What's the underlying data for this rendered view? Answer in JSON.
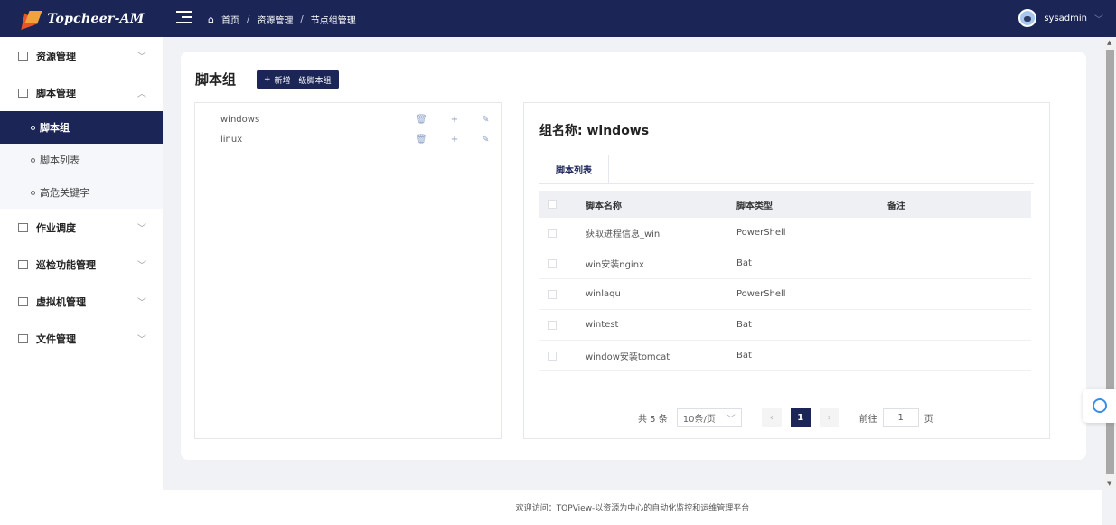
{
  "brand": {
    "logo_text": "Topcheer-AM"
  },
  "breadcrumb": {
    "home": "首页",
    "items": [
      "资源管理",
      "节点组管理"
    ],
    "separator": "/"
  },
  "user": {
    "name": "sysadmin"
  },
  "sidebar": {
    "items": [
      {
        "label": "资源管理",
        "arrow": "﹀"
      },
      {
        "label": "脚本管理",
        "arrow": "︿"
      },
      {
        "label": "作业调度",
        "arrow": "﹀"
      },
      {
        "label": "巡检功能管理",
        "arrow": "﹀"
      },
      {
        "label": "虚拟机管理",
        "arrow": "﹀"
      },
      {
        "label": "文件管理",
        "arrow": "﹀"
      }
    ],
    "sub_items": [
      {
        "label": "脚本组",
        "active": true
      },
      {
        "label": "脚本列表",
        "active": false
      },
      {
        "label": "高危关键字",
        "active": false
      }
    ]
  },
  "main": {
    "title": "脚本组",
    "add_button": "新增一级脚本组",
    "tree": [
      {
        "label": "windows"
      },
      {
        "label": "linux"
      }
    ],
    "detail": {
      "group_label": "组名称: windows",
      "tab": "脚本列表",
      "columns": [
        "脚本名称",
        "脚本类型",
        "备注"
      ],
      "rows": [
        {
          "name": "获取进程信息_win",
          "type": "PowerShell",
          "note": ""
        },
        {
          "name": "win安装nginx",
          "type": "Bat",
          "note": ""
        },
        {
          "name": "winlaqu",
          "type": "PowerShell",
          "note": ""
        },
        {
          "name": "wintest",
          "type": "Bat",
          "note": ""
        },
        {
          "name": "window安装tomcat",
          "type": "Bat",
          "note": ""
        }
      ],
      "pagination": {
        "total": "共 5 条",
        "page_size": "10条/页",
        "current": "1",
        "goto_label": "前往",
        "goto_value": "1",
        "page_unit": "页"
      }
    }
  },
  "footer": "欢迎访问：TOPView-以资源为中心的自动化监控和运维管理平台",
  "colors": {
    "primary": "#1b2556",
    "accent": "#e8532b"
  }
}
